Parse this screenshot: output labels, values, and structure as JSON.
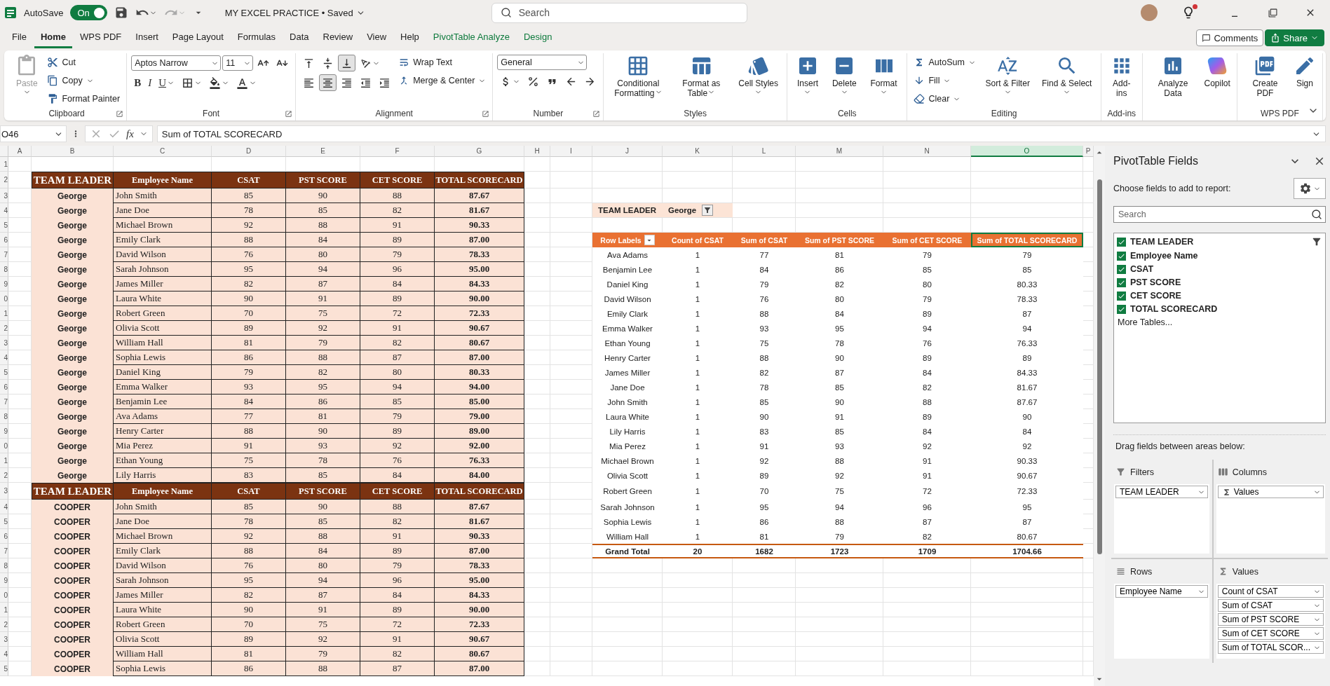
{
  "title_bar": {
    "autosave_label": "AutoSave",
    "autosave_on": true,
    "autosave_state": "On",
    "file_title": "MY EXCEL PRACTICE • Saved",
    "search_placeholder": "Search"
  },
  "menu_tabs": [
    {
      "label": "File",
      "selected": false,
      "kind": "normal"
    },
    {
      "label": "Home",
      "selected": true,
      "kind": "normal"
    },
    {
      "label": "WPS PDF",
      "selected": false,
      "kind": "normal"
    },
    {
      "label": "Insert",
      "selected": false,
      "kind": "normal"
    },
    {
      "label": "Page Layout",
      "selected": false,
      "kind": "normal"
    },
    {
      "label": "Formulas",
      "selected": false,
      "kind": "normal"
    },
    {
      "label": "Data",
      "selected": false,
      "kind": "normal"
    },
    {
      "label": "Review",
      "selected": false,
      "kind": "normal"
    },
    {
      "label": "View",
      "selected": false,
      "kind": "normal"
    },
    {
      "label": "Help",
      "selected": false,
      "kind": "normal"
    },
    {
      "label": "PivotTable Analyze",
      "selected": false,
      "kind": "contextual"
    },
    {
      "label": "Design",
      "selected": false,
      "kind": "contextual"
    }
  ],
  "header_buttons": {
    "comments": "Comments",
    "share": "Share"
  },
  "ribbon": [
    {
      "label": "Clipboard",
      "cells": [
        {
          "kind": "large",
          "label": "Paste",
          "disabled": true,
          "dropdown": true
        },
        {
          "kind": "stack",
          "items": [
            {
              "kind": "small",
              "label": "Cut"
            },
            {
              "kind": "small",
              "label": "Copy",
              "dropdown": true
            },
            {
              "kind": "small",
              "label": "Format Painter"
            }
          ]
        }
      ]
    },
    {
      "label": "Font",
      "cells": [
        {
          "kind": "stack",
          "items": [
            {
              "kind": "row",
              "items": [
                {
                  "kind": "select",
                  "value": "Aptos Narrow"
                },
                {
                  "kind": "select",
                  "value": "11"
                },
                {
                  "kind": "icon"
                },
                {
                  "kind": "icon"
                }
              ]
            },
            {
              "kind": "row",
              "items": [
                {
                  "kind": "letter",
                  "label": "B"
                },
                {
                  "kind": "letter",
                  "label": "I"
                },
                {
                  "kind": "letter",
                  "label": "U",
                  "dropdown": true
                },
                {
                  "kind": "icon",
                  "dropdown": true
                },
                {
                  "kind": "icon",
                  "dropdown": true
                },
                {
                  "kind": "icon",
                  "dropdown": true
                }
              ]
            }
          ]
        }
      ]
    },
    {
      "label": "Alignment",
      "cells": [
        {
          "kind": "stack",
          "items": [
            {
              "kind": "row",
              "items": [
                {
                  "kind": "icon",
                  "selected": false
                },
                {
                  "kind": "icon",
                  "selected": false
                },
                {
                  "kind": "icon",
                  "selected": true
                },
                {
                  "kind": "icon",
                  "dropdown": true
                }
              ]
            },
            {
              "kind": "row",
              "items": [
                {
                  "kind": "icon",
                  "selected": false
                },
                {
                  "kind": "icon",
                  "selected": true
                },
                {
                  "kind": "icon",
                  "selected": false
                },
                {
                  "kind": "icon"
                },
                {
                  "kind": "icon"
                }
              ]
            }
          ]
        },
        {
          "kind": "stack",
          "items": [
            {
              "kind": "small",
              "label": "Wrap Text"
            },
            {
              "kind": "small",
              "label": "Merge & Center",
              "dropdown": true
            }
          ]
        }
      ]
    },
    {
      "label": "Number",
      "cells": [
        {
          "kind": "stack",
          "items": [
            {
              "kind": "select",
              "value": "General"
            },
            {
              "kind": "row",
              "items": [
                {
                  "kind": "icon",
                  "dropdown": true
                },
                {
                  "kind": "icon"
                },
                {
                  "kind": "icon"
                },
                {
                  "kind": "icon"
                },
                {
                  "kind": "icon"
                }
              ]
            }
          ]
        }
      ]
    },
    {
      "label": "Styles",
      "cells": [
        {
          "kind": "large",
          "label": "Conditional Formatting",
          "dropdown": true
        },
        {
          "kind": "large",
          "label": "Format as Table",
          "dropdown": true
        },
        {
          "kind": "large",
          "label": "Cell Styles",
          "dropdown": true
        }
      ]
    },
    {
      "label": "Cells",
      "cells": [
        {
          "kind": "large",
          "label": "Insert",
          "dropdown": true
        },
        {
          "kind": "large",
          "label": "Delete",
          "dropdown": true
        },
        {
          "kind": "large",
          "label": "Format",
          "dropdown": true
        }
      ]
    },
    {
      "label": "Editing",
      "cells": [
        {
          "kind": "stack",
          "items": [
            {
              "kind": "small",
              "label": "AutoSum",
              "dropdown": true
            },
            {
              "kind": "small",
              "label": "Fill",
              "dropdown": true
            },
            {
              "kind": "small",
              "label": "Clear",
              "dropdown": true
            }
          ]
        },
        {
          "kind": "large",
          "label": "Sort & Filter",
          "dropdown": true
        },
        {
          "kind": "large",
          "label": "Find & Select",
          "dropdown": true
        }
      ]
    },
    {
      "label": "Add-ins",
      "cells": [
        {
          "kind": "large",
          "label": "Add-ins"
        }
      ]
    },
    {
      "cells": [
        {
          "kind": "large",
          "label": "Analyze Data"
        },
        {
          "kind": "large",
          "label": "Copilot"
        }
      ]
    },
    {
      "label": "WPS PDF",
      "cells": [
        {
          "kind": "large",
          "label": "Create PDF"
        },
        {
          "kind": "large",
          "label": "Sign"
        }
      ]
    }
  ],
  "formula_bar": {
    "name_box": "O46",
    "function_label": "fx",
    "formula": "Sum of TOTAL SCORECARD"
  },
  "column_headers": [
    {
      "label": "A",
      "selected": false
    },
    {
      "label": "B",
      "selected": false
    },
    {
      "label": "C",
      "selected": false
    },
    {
      "label": "D",
      "selected": false
    },
    {
      "label": "E",
      "selected": false
    },
    {
      "label": "F",
      "selected": false
    },
    {
      "label": "G",
      "selected": false
    },
    {
      "label": "H",
      "selected": false
    },
    {
      "label": "I",
      "selected": false
    },
    {
      "label": "J",
      "selected": false
    },
    {
      "label": "K",
      "selected": false
    },
    {
      "label": "L",
      "selected": false
    },
    {
      "label": "M",
      "selected": false
    },
    {
      "label": "N",
      "selected": false
    },
    {
      "label": "O",
      "selected": true
    },
    {
      "label": "P",
      "selected": false
    }
  ],
  "row_numbers": [
    "1",
    "2",
    "3",
    "4",
    "5",
    "6",
    "7",
    "8",
    "9",
    "0",
    "1",
    "2",
    "3",
    "4",
    "5",
    "6",
    "7",
    "8",
    "9",
    "0",
    "1",
    "2",
    "3",
    "4",
    "5",
    "6",
    "7",
    "8",
    "9",
    "0",
    "1",
    "2",
    "3",
    "4",
    "5"
  ],
  "table": {
    "sections": [
      {
        "header": [
          "TEAM LEADER",
          "Employee Name",
          "CSAT",
          "PST SCORE",
          "CET SCORE",
          "TOTAL SCORECARD"
        ],
        "rows": [
          [
            "George",
            "John Smith",
            "85",
            "90",
            "88",
            "87.67"
          ],
          [
            "George",
            "Jane Doe",
            "78",
            "85",
            "82",
            "81.67"
          ],
          [
            "George",
            "Michael Brown",
            "92",
            "88",
            "91",
            "90.33"
          ],
          [
            "George",
            "Emily Clark",
            "88",
            "84",
            "89",
            "87.00"
          ],
          [
            "George",
            "David Wilson",
            "76",
            "80",
            "79",
            "78.33"
          ],
          [
            "George",
            "Sarah Johnson",
            "95",
            "94",
            "96",
            "95.00"
          ],
          [
            "George",
            "James Miller",
            "82",
            "87",
            "84",
            "84.33"
          ],
          [
            "George",
            "Laura White",
            "90",
            "91",
            "89",
            "90.00"
          ],
          [
            "George",
            "Robert Green",
            "70",
            "75",
            "72",
            "72.33"
          ],
          [
            "George",
            "Olivia Scott",
            "89",
            "92",
            "91",
            "90.67"
          ],
          [
            "George",
            "William Hall",
            "81",
            "79",
            "82",
            "80.67"
          ],
          [
            "George",
            "Sophia Lewis",
            "86",
            "88",
            "87",
            "87.00"
          ],
          [
            "George",
            "Daniel King",
            "79",
            "82",
            "80",
            "80.33"
          ],
          [
            "George",
            "Emma Walker",
            "93",
            "95",
            "94",
            "94.00"
          ],
          [
            "George",
            "Benjamin Lee",
            "84",
            "86",
            "85",
            "85.00"
          ],
          [
            "George",
            "Ava Adams",
            "77",
            "81",
            "79",
            "79.00"
          ],
          [
            "George",
            "Henry Carter",
            "88",
            "90",
            "89",
            "89.00"
          ],
          [
            "George",
            "Mia Perez",
            "91",
            "93",
            "92",
            "92.00"
          ],
          [
            "George",
            "Ethan Young",
            "75",
            "78",
            "76",
            "76.33"
          ],
          [
            "George",
            "Lily Harris",
            "83",
            "85",
            "84",
            "84.00"
          ]
        ]
      },
      {
        "header": [
          "TEAM LEADER",
          "Employee Name",
          "CSAT",
          "PST SCORE",
          "CET SCORE",
          "TOTAL SCORECARD"
        ],
        "rows": [
          [
            "COOPER",
            "John Smith",
            "85",
            "90",
            "88",
            "87.67"
          ],
          [
            "COOPER",
            "Jane Doe",
            "78",
            "85",
            "82",
            "81.67"
          ],
          [
            "COOPER",
            "Michael Brown",
            "92",
            "88",
            "91",
            "90.33"
          ],
          [
            "COOPER",
            "Emily Clark",
            "88",
            "84",
            "89",
            "87.00"
          ],
          [
            "COOPER",
            "David Wilson",
            "76",
            "80",
            "79",
            "78.33"
          ],
          [
            "COOPER",
            "Sarah Johnson",
            "95",
            "94",
            "96",
            "95.00"
          ],
          [
            "COOPER",
            "James Miller",
            "82",
            "87",
            "84",
            "84.33"
          ],
          [
            "COOPER",
            "Laura White",
            "90",
            "91",
            "89",
            "90.00"
          ],
          [
            "COOPER",
            "Robert Green",
            "70",
            "75",
            "72",
            "72.33"
          ],
          [
            "COOPER",
            "Olivia Scott",
            "89",
            "92",
            "91",
            "90.67"
          ],
          [
            "COOPER",
            "William Hall",
            "81",
            "79",
            "82",
            "80.67"
          ],
          [
            "COOPER",
            "Sophia Lewis",
            "86",
            "88",
            "87",
            "87.00"
          ]
        ]
      }
    ]
  },
  "pivot": {
    "filter": {
      "label": "TEAM LEADER",
      "value": "George"
    },
    "columns": [
      {
        "label": "Row Labels",
        "selected": false
      },
      {
        "label": "Count of CSAT",
        "selected": false
      },
      {
        "label": "Sum of CSAT",
        "selected": false
      },
      {
        "label": "Sum of PST SCORE",
        "selected": false
      },
      {
        "label": "Sum of CET SCORE",
        "selected": false
      },
      {
        "label": "Sum of TOTAL SCORECARD",
        "selected": true
      }
    ],
    "rows": [
      [
        "Ava Adams",
        "1",
        "77",
        "81",
        "79",
        "79"
      ],
      [
        "Benjamin Lee",
        "1",
        "84",
        "86",
        "85",
        "85"
      ],
      [
        "Daniel King",
        "1",
        "79",
        "82",
        "80",
        "80.33"
      ],
      [
        "David Wilson",
        "1",
        "76",
        "80",
        "79",
        "78.33"
      ],
      [
        "Emily Clark",
        "1",
        "88",
        "84",
        "89",
        "87"
      ],
      [
        "Emma Walker",
        "1",
        "93",
        "95",
        "94",
        "94"
      ],
      [
        "Ethan Young",
        "1",
        "75",
        "78",
        "76",
        "76.33"
      ],
      [
        "Henry Carter",
        "1",
        "88",
        "90",
        "89",
        "89"
      ],
      [
        "James Miller",
        "1",
        "82",
        "87",
        "84",
        "84.33"
      ],
      [
        "Jane Doe",
        "1",
        "78",
        "85",
        "82",
        "81.67"
      ],
      [
        "John Smith",
        "1",
        "85",
        "90",
        "88",
        "87.67"
      ],
      [
        "Laura White",
        "1",
        "90",
        "91",
        "89",
        "90"
      ],
      [
        "Lily Harris",
        "1",
        "83",
        "85",
        "84",
        "84"
      ],
      [
        "Mia Perez",
        "1",
        "91",
        "93",
        "92",
        "92"
      ],
      [
        "Michael Brown",
        "1",
        "92",
        "88",
        "91",
        "90.33"
      ],
      [
        "Olivia Scott",
        "1",
        "89",
        "92",
        "91",
        "90.67"
      ],
      [
        "Robert Green",
        "1",
        "70",
        "75",
        "72",
        "72.33"
      ],
      [
        "Sarah Johnson",
        "1",
        "95",
        "94",
        "96",
        "95"
      ],
      [
        "Sophia Lewis",
        "1",
        "86",
        "88",
        "87",
        "87"
      ],
      [
        "William Hall",
        "1",
        "81",
        "79",
        "82",
        "80.67"
      ]
    ],
    "grand_total": [
      "Grand Total",
      "20",
      "1682",
      "1723",
      "1709",
      "1704.66"
    ]
  },
  "field_pane": {
    "title": "PivotTable Fields",
    "subtitle": "Choose fields to add to report:",
    "search_placeholder": "Search",
    "fields": [
      {
        "label": "TEAM LEADER",
        "checked": true,
        "filtered": true
      },
      {
        "label": "Employee Name",
        "checked": true,
        "filtered": false
      },
      {
        "label": "CSAT",
        "checked": true,
        "filtered": false
      },
      {
        "label": "PST SCORE",
        "checked": true,
        "filtered": false
      },
      {
        "label": "CET SCORE",
        "checked": true,
        "filtered": false
      },
      {
        "label": "TOTAL SCORECARD",
        "checked": true,
        "filtered": false
      }
    ],
    "more_tables": "More Tables...",
    "areas_hint": "Drag fields between areas below:",
    "areas": [
      {
        "kind": "filters",
        "label": "Filters",
        "items": [
          "TEAM LEADER"
        ]
      },
      {
        "kind": "columns",
        "label": "Columns",
        "items": [
          "Values"
        ]
      },
      {
        "kind": "rows",
        "label": "Rows",
        "items": [
          "Employee Name"
        ]
      },
      {
        "kind": "values",
        "label": "Values",
        "items": [
          "Count of CSAT",
          "Sum of CSAT",
          "Sum of PST SCORE",
          "Sum of CET SCORE",
          "Sum of TOTAL SCOR..."
        ]
      }
    ]
  }
}
